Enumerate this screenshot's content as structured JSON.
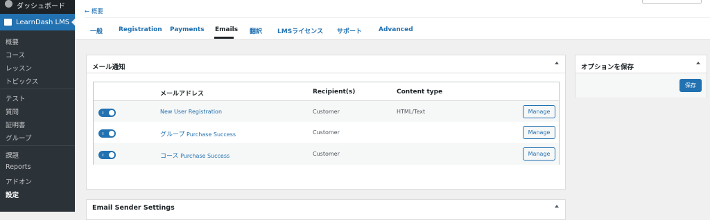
{
  "sidebar": {
    "dashboard_label": "ダッシュボード",
    "active_label": "LearnDash LMS",
    "items": [
      "概要",
      "コース",
      "レッスン",
      "トピックス",
      "テスト",
      "質問",
      "証明書",
      "グループ",
      "課題",
      "Reports",
      "アドオン",
      "設定"
    ]
  },
  "header": {
    "back_link": "← 概要",
    "tabs": [
      "一般",
      "Registration",
      "Payments",
      "Emails",
      "翻訳",
      "LMSライセンス",
      "サポート",
      "Advanced"
    ],
    "active_tab": "Emails"
  },
  "email_panel": {
    "title": "メール通知",
    "columns": [
      "メールアドレス",
      "Recipient(s)",
      "Content type"
    ],
    "rows": [
      {
        "name_jp": "",
        "name": "New User Registration",
        "recipient": "Customer",
        "content_type": "HTML/Text",
        "enabled": true,
        "action": "Manage"
      },
      {
        "name_jp": "グループ",
        "name": "Purchase Success",
        "recipient": "Customer",
        "content_type": "",
        "enabled": true,
        "action": "Manage"
      },
      {
        "name_jp": "コース",
        "name": "Purchase Success",
        "recipient": "Customer",
        "content_type": "",
        "enabled": true,
        "action": "Manage"
      }
    ]
  },
  "sender_panel": {
    "title": "Email Sender Settings"
  },
  "save_panel": {
    "title": "オプションを保存",
    "save_label": "保存"
  },
  "colors": {
    "accent": "#2271b1",
    "sidebar_bg": "#1d2327",
    "submenu_bg": "#2c3338"
  }
}
